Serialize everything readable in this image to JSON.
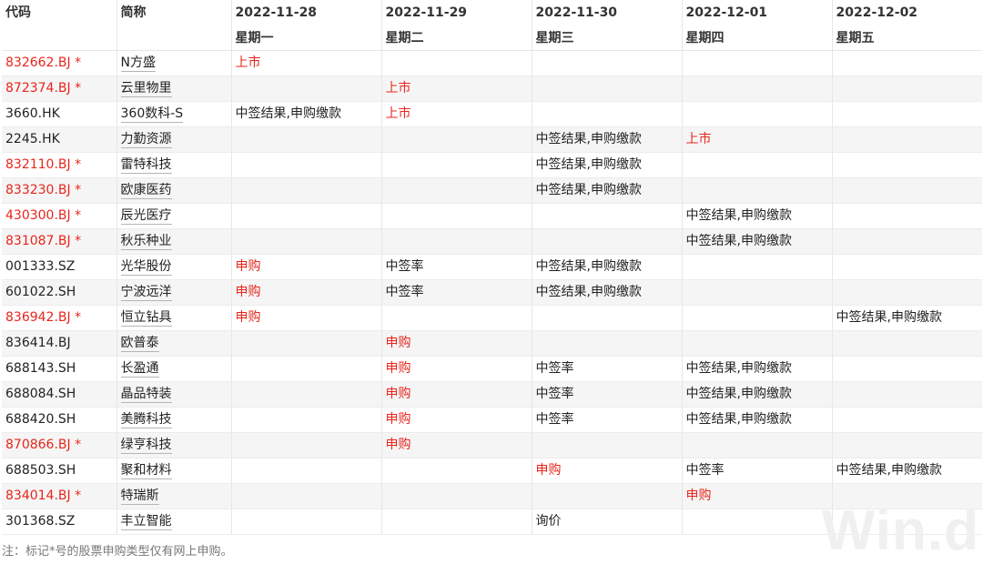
{
  "table": {
    "header": {
      "code_label": "代码",
      "name_label": "简称",
      "dates": [
        {
          "date": "2022-11-28",
          "weekday": "星期一"
        },
        {
          "date": "2022-11-29",
          "weekday": "星期二"
        },
        {
          "date": "2022-11-30",
          "weekday": "星期三"
        },
        {
          "date": "2022-12-01",
          "weekday": "星期四"
        },
        {
          "date": "2022-12-02",
          "weekday": "星期五"
        }
      ]
    },
    "rows": [
      {
        "code": "832662.BJ *",
        "code_color": "red",
        "name": "N方盛",
        "cells": [
          {
            "text": "上市",
            "color": "red"
          },
          null,
          null,
          null,
          null
        ]
      },
      {
        "code": "872374.BJ *",
        "code_color": "red",
        "name": "云里物里",
        "cells": [
          null,
          {
            "text": "上市",
            "color": "red"
          },
          null,
          null,
          null
        ]
      },
      {
        "code": "3660.HK",
        "code_color": "default",
        "name": "360数科-S",
        "cells": [
          {
            "text": "中签结果,申购缴款",
            "color": "default"
          },
          {
            "text": "上市",
            "color": "red"
          },
          null,
          null,
          null
        ]
      },
      {
        "code": "2245.HK",
        "code_color": "default",
        "name": "力勤资源",
        "cells": [
          null,
          null,
          {
            "text": "中签结果,申购缴款",
            "color": "default"
          },
          {
            "text": "上市",
            "color": "red"
          },
          null
        ]
      },
      {
        "code": "832110.BJ *",
        "code_color": "red",
        "name": "雷特科技",
        "cells": [
          null,
          null,
          {
            "text": "中签结果,申购缴款",
            "color": "default"
          },
          null,
          null
        ]
      },
      {
        "code": "833230.BJ *",
        "code_color": "red",
        "name": "欧康医药",
        "cells": [
          null,
          null,
          {
            "text": "中签结果,申购缴款",
            "color": "default"
          },
          null,
          null
        ]
      },
      {
        "code": "430300.BJ *",
        "code_color": "red",
        "name": "辰光医疗",
        "cells": [
          null,
          null,
          null,
          {
            "text": "中签结果,申购缴款",
            "color": "default"
          },
          null
        ]
      },
      {
        "code": "831087.BJ *",
        "code_color": "red",
        "name": "秋乐种业",
        "cells": [
          null,
          null,
          null,
          {
            "text": "中签结果,申购缴款",
            "color": "default"
          },
          null
        ]
      },
      {
        "code": "001333.SZ",
        "code_color": "default",
        "name": "光华股份",
        "cells": [
          {
            "text": "申购",
            "color": "red"
          },
          {
            "text": "中签率",
            "color": "default"
          },
          {
            "text": "中签结果,申购缴款",
            "color": "default"
          },
          null,
          null
        ]
      },
      {
        "code": "601022.SH",
        "code_color": "default",
        "name": "宁波远洋",
        "cells": [
          {
            "text": "申购",
            "color": "red"
          },
          {
            "text": "中签率",
            "color": "default"
          },
          {
            "text": "中签结果,申购缴款",
            "color": "default"
          },
          null,
          null
        ]
      },
      {
        "code": "836942.BJ *",
        "code_color": "red",
        "name": "恒立钻具",
        "cells": [
          {
            "text": "申购",
            "color": "red"
          },
          null,
          null,
          null,
          {
            "text": "中签结果,申购缴款",
            "color": "default"
          }
        ]
      },
      {
        "code": "836414.BJ",
        "code_color": "default",
        "name": "欧普泰",
        "cells": [
          null,
          {
            "text": "申购",
            "color": "red"
          },
          null,
          null,
          null
        ]
      },
      {
        "code": "688143.SH",
        "code_color": "default",
        "name": "长盈通",
        "cells": [
          null,
          {
            "text": "申购",
            "color": "red"
          },
          {
            "text": "中签率",
            "color": "default"
          },
          {
            "text": "中签结果,申购缴款",
            "color": "default"
          },
          null
        ]
      },
      {
        "code": "688084.SH",
        "code_color": "default",
        "name": "晶品特装",
        "cells": [
          null,
          {
            "text": "申购",
            "color": "red"
          },
          {
            "text": "中签率",
            "color": "default"
          },
          {
            "text": "中签结果,申购缴款",
            "color": "default"
          },
          null
        ]
      },
      {
        "code": "688420.SH",
        "code_color": "default",
        "name": "美腾科技",
        "cells": [
          null,
          {
            "text": "申购",
            "color": "red"
          },
          {
            "text": "中签率",
            "color": "default"
          },
          {
            "text": "中签结果,申购缴款",
            "color": "default"
          },
          null
        ]
      },
      {
        "code": "870866.BJ *",
        "code_color": "red",
        "name": "绿亨科技",
        "cells": [
          null,
          {
            "text": "申购",
            "color": "red"
          },
          null,
          null,
          null
        ]
      },
      {
        "code": "688503.SH",
        "code_color": "default",
        "name": "聚和材料",
        "cells": [
          null,
          null,
          {
            "text": "申购",
            "color": "red"
          },
          {
            "text": "中签率",
            "color": "default"
          },
          {
            "text": "中签结果,申购缴款",
            "color": "default"
          }
        ]
      },
      {
        "code": "834014.BJ *",
        "code_color": "red",
        "name": "特瑞斯",
        "cells": [
          null,
          null,
          null,
          {
            "text": "申购",
            "color": "red"
          },
          null
        ]
      },
      {
        "code": "301368.SZ",
        "code_color": "default",
        "name": "丰立智能",
        "cells": [
          null,
          null,
          {
            "text": "询价",
            "color": "default"
          },
          null,
          null
        ]
      }
    ]
  },
  "footnote": "注：标记*号的股票申购类型仅有网上申购。",
  "watermark": "Win.d",
  "colors": {
    "red": "#e8251c",
    "default": "#222222",
    "stripe": "#f5f5f5"
  }
}
